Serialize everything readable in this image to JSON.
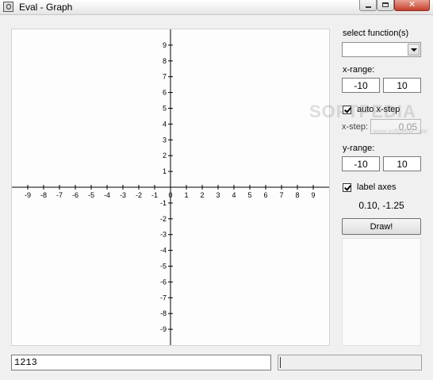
{
  "window": {
    "title": "Eval - Graph"
  },
  "sidebar": {
    "select_label": "select function(s)",
    "selected_function": "",
    "x_range_label": "x-range:",
    "x_min": "-10",
    "x_max": "10",
    "auto_step_label": "auto x-step",
    "auto_step_checked": true,
    "x_step_label": "x-step:",
    "x_step_value": "0.05",
    "y_range_label": "y-range:",
    "y_min": "-10",
    "y_max": "10",
    "label_axes_label": "label axes",
    "label_axes_checked": true,
    "coordinates": "0.10, -1.25",
    "draw_button": "Draw!"
  },
  "watermark": {
    "text": "SOFTPEDIA",
    "sub": "www.softpedia.com"
  },
  "expression": {
    "value": "1213"
  },
  "graph": {
    "x_range": [
      -10,
      10
    ],
    "y_range": [
      -10,
      10
    ],
    "x_tick_labels": [
      "-9",
      "-8",
      "-7",
      "-6",
      "-5",
      "-4",
      "-3",
      "-2",
      "-1",
      "0",
      "1",
      "2",
      "3",
      "4",
      "5",
      "6",
      "7",
      "8",
      "9"
    ],
    "y_tick_labels": [
      "9",
      "8",
      "7",
      "6",
      "5",
      "4",
      "3",
      "2",
      "1",
      "-1",
      "-2",
      "-3",
      "-4",
      "-5",
      "-6",
      "-7",
      "-8",
      "-9"
    ]
  },
  "colors": {
    "axis": "#000000",
    "background": "#fdfdfd",
    "close_button": "#c7402c"
  }
}
